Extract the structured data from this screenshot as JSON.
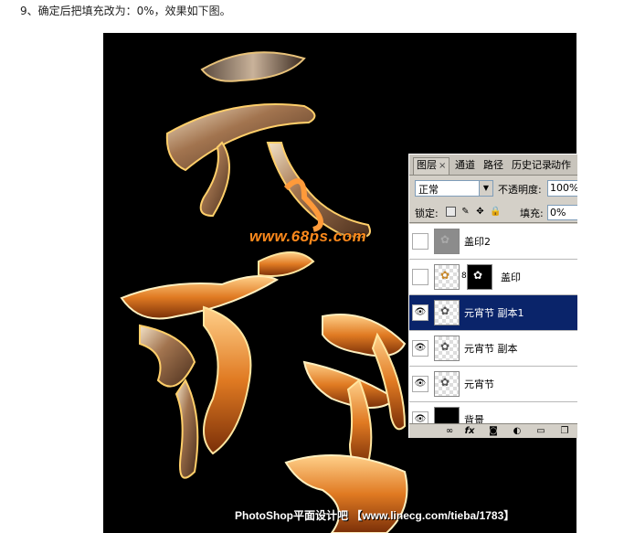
{
  "caption": "9、确定后把填充改为：0%，效果如下图。",
  "watermark_site": "www.68ps.com",
  "watermark_footer": "PhotoShop平面设计吧 【www.linecg.com/tieba/1783】",
  "panel": {
    "tabs": [
      {
        "label": "图层",
        "close": "×"
      },
      {
        "label": "通道"
      },
      {
        "label": "路径"
      },
      {
        "label": "历史记录"
      },
      {
        "label": "动作"
      }
    ],
    "blend_mode": "正常",
    "opacity_label": "不透明度:",
    "opacity_value": "100%",
    "lock_label": "锁定:",
    "fill_label": "填充:",
    "fill_value": "0%",
    "layers": [
      {
        "name": "盖印2",
        "visible": false,
        "thumb": "gray",
        "selected": false
      },
      {
        "name": "盖印",
        "visible": false,
        "thumb": "checker",
        "mask": true,
        "selected": false
      },
      {
        "name": "元宵节 副本1",
        "visible": true,
        "thumb": "checker",
        "selected": true
      },
      {
        "name": "元宵节 副本",
        "visible": true,
        "thumb": "checker",
        "selected": false
      },
      {
        "name": "元宵节",
        "visible": true,
        "thumb": "checker",
        "selected": false
      },
      {
        "name": "背景",
        "visible": true,
        "thumb": "black",
        "selected": false
      }
    ],
    "icons": [
      "link-icon",
      "fx-icon",
      "mask-icon",
      "adjustment-icon",
      "folder-icon",
      "new-layer-icon"
    ]
  },
  "colors": {
    "selection": "#0a246a",
    "panel_bg": "#d4d0c8",
    "glow_orange": "#ff8a1c"
  }
}
